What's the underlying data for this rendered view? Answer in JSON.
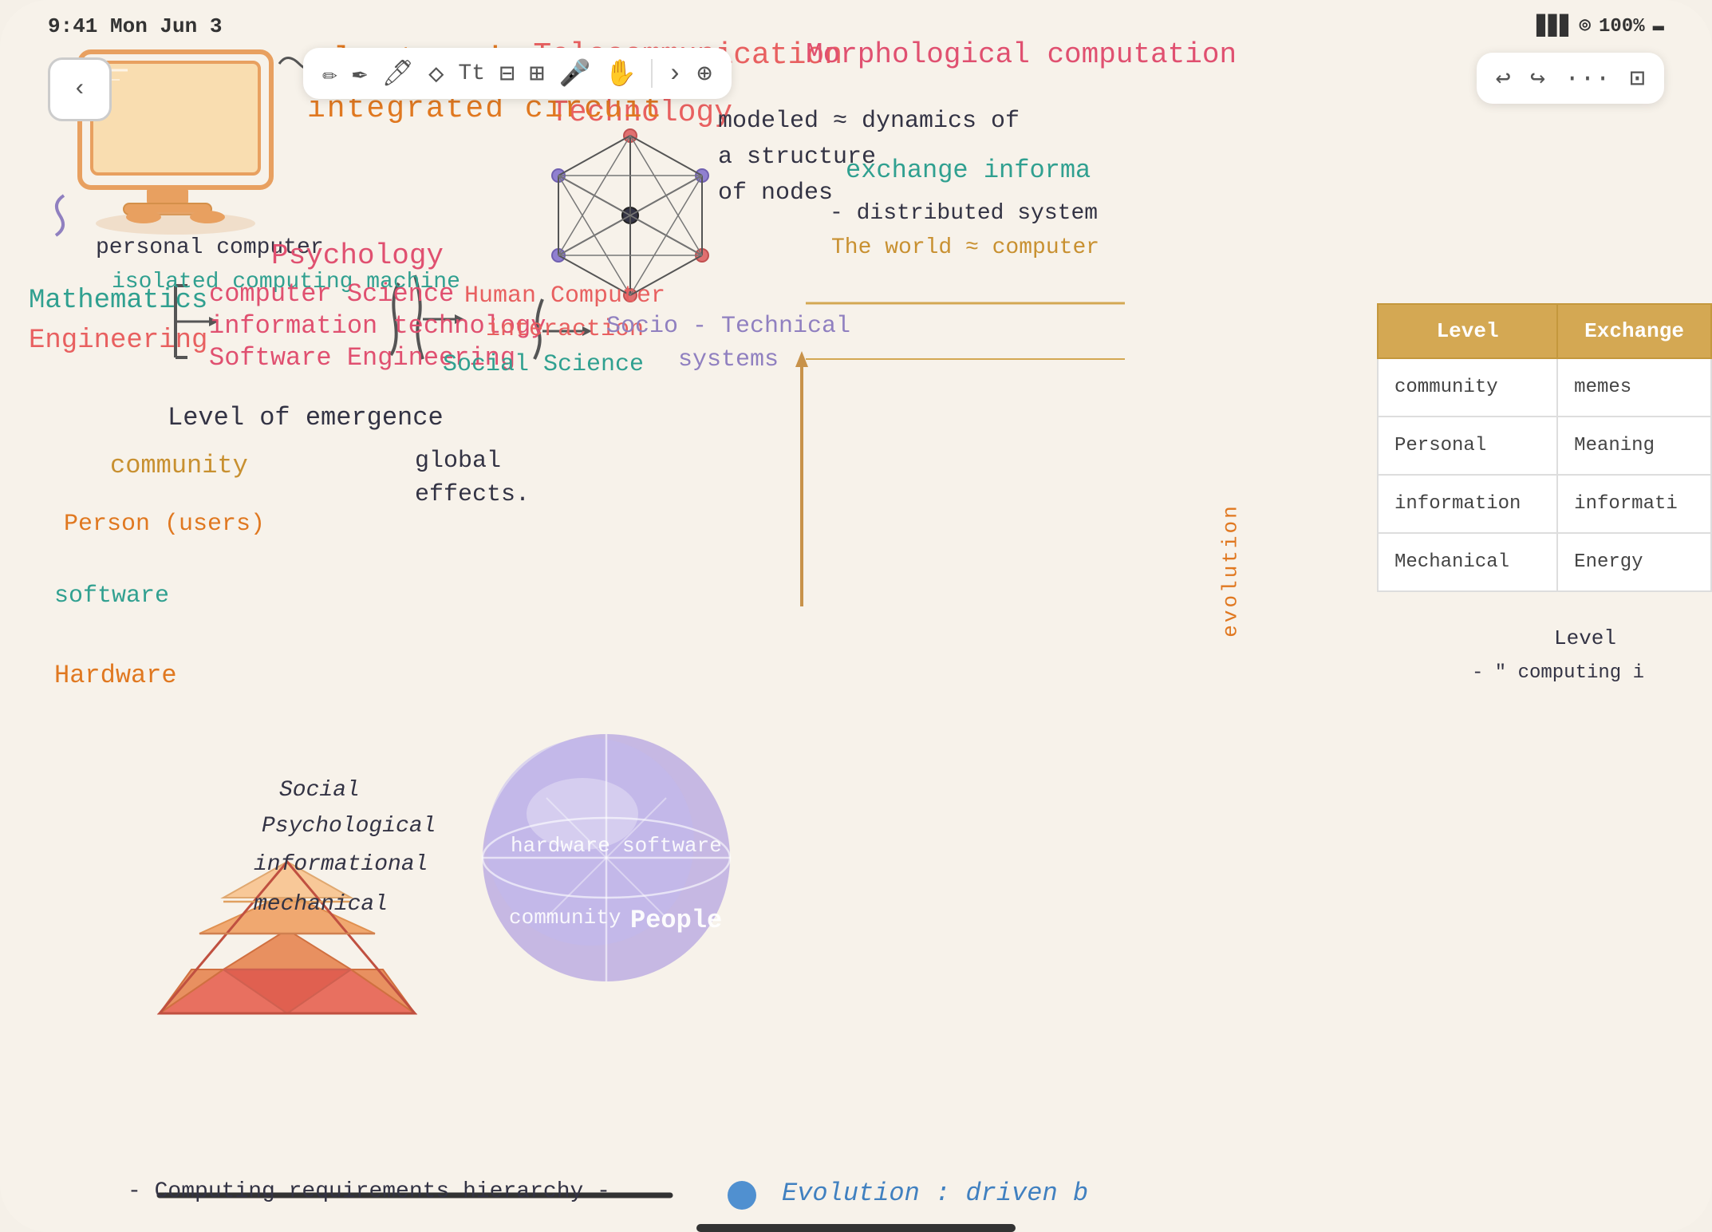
{
  "statusBar": {
    "time": "9:41 Mon Jun 3",
    "signal": "▊▊▊",
    "wifi": "WiFi",
    "battery": "100%"
  },
  "toolbar": {
    "back": "‹",
    "tools": [
      "✏️",
      "✒️",
      "🖊️",
      "◇",
      "T",
      "⊟",
      "⊞",
      "🎤",
      "✋",
      "›"
    ]
  },
  "topRightTools": [
    "↩",
    "↪",
    "···",
    "⊡"
  ],
  "texts": {
    "electronics": "electronics",
    "telecommunication": "···Telecommunication",
    "morphological": "Morphological computation",
    "integratedCircuit": "integrated circuit",
    "technology": "Technology",
    "nodedDynamics": "modeled ≈ dynamics of a structure",
    "ofNodes": "of nodes",
    "exchange": "exchange informa",
    "distributedSystem": "- distributed system",
    "theWorldComputer": "The world ≈ computer",
    "personalComputer": "personal computer",
    "isolatedMachine": "isolated computing machine",
    "psychology": "Psychology",
    "mathematics": "Mathematics",
    "engineering": "Engineering",
    "computerScience": "computer Science",
    "informationTechnology": "information technology",
    "softwareEngineering": "Software Engineering",
    "humanComputer": "Human Computer",
    "interaction": "interaction",
    "socialScience": "Social Science",
    "socioTechnical": "Socio - Technical",
    "systems": "systems",
    "levelOfEmergence": "Level of emergence",
    "community": "community",
    "personUsers": "Person (users)",
    "software": "software",
    "hardware": "Hardware",
    "globalEffects": "global effects.",
    "computingRequirements": "- Computing requirements hierarchy -",
    "evolutionDriven": "Evolution : driven b",
    "pyramidLevels": {
      "social": "Social",
      "psychological": "Psychological",
      "informational": "informational",
      "mechanical": "mechanical"
    },
    "globeQuadrants": {
      "hardware": "hardware",
      "software": "software",
      "community": "community",
      "people": "People"
    },
    "tableHeaders": [
      "Level",
      "Exchange"
    ],
    "tableRows": [
      [
        "community",
        "memes"
      ],
      [
        "Personal",
        "Meaning"
      ],
      [
        "information",
        "informati"
      ],
      [
        "Mechanical",
        "Energy"
      ]
    ],
    "levelLabel": "Level",
    "computingLabel": "- \" computing i",
    "evolutionLabel": "evolution"
  }
}
